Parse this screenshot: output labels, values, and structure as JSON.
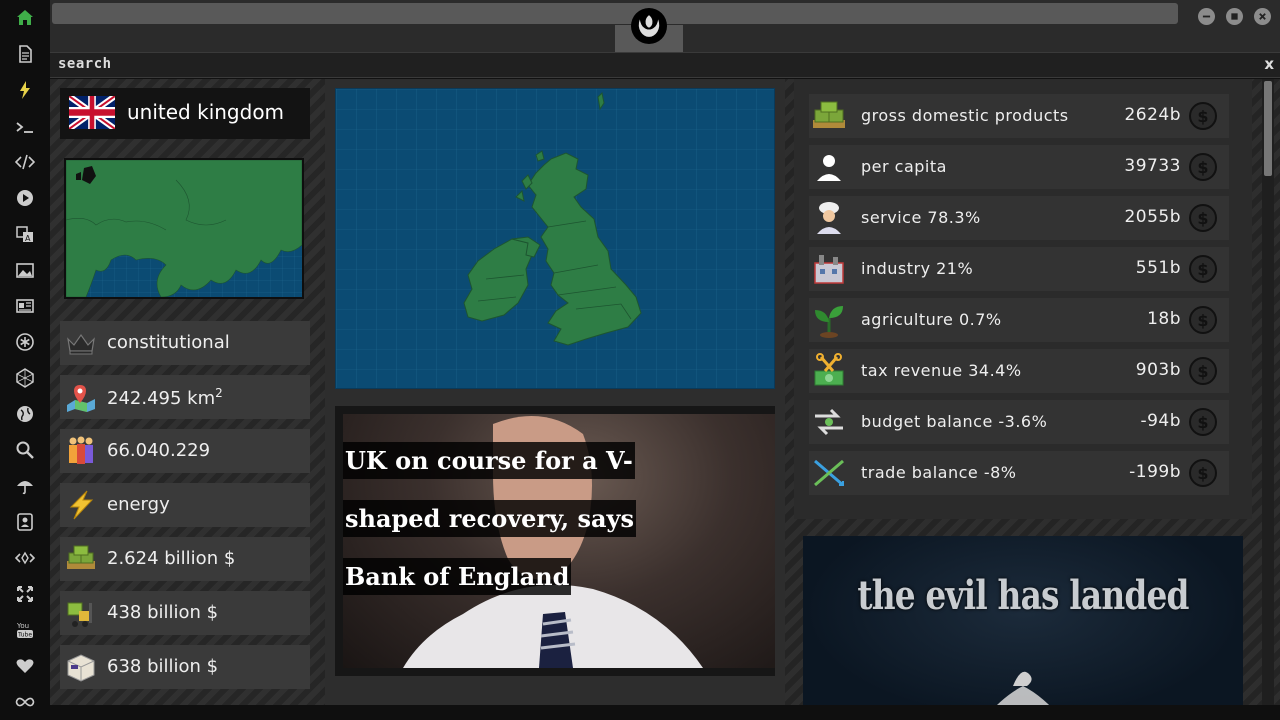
{
  "nav": {
    "icons": [
      "home-icon",
      "document-icon",
      "bolt-icon",
      "terminal-icon",
      "code-icon",
      "play-icon",
      "translate-icon",
      "image-icon",
      "newspaper-icon",
      "asterisk-icon",
      "hexagon-icon",
      "globe-icon",
      "search-icon",
      "umbrella-icon",
      "contact-icon",
      "ethereum-icon",
      "fullscreen-icon",
      "youtube-icon",
      "heart-icon",
      "infinity-icon"
    ]
  },
  "search": {
    "label": "search",
    "close": "x"
  },
  "country": {
    "name": "united kingdom",
    "government": "constitutional",
    "area": "242.495 km",
    "area_unit_sup": "2",
    "population": "66.040.229",
    "sector": "energy",
    "gdp": "2.624 billion $",
    "imports": "438 billion $",
    "exports": "638 billion $"
  },
  "news": {
    "headline": "UK on course for a V-shaped recovery, says Bank of England"
  },
  "stats": [
    {
      "label": "gross domestic products",
      "value": "2624b"
    },
    {
      "label": "per capita",
      "value": "39733"
    },
    {
      "label": "service 78.3%",
      "value": "2055b"
    },
    {
      "label": "industry 21%",
      "value": "551b"
    },
    {
      "label": "agriculture 0.7%",
      "value": "18b"
    },
    {
      "label": "tax revenue 34.4%",
      "value": "903b"
    },
    {
      "label": "budget balance -3.6%",
      "value": "-94b"
    },
    {
      "label": "trade balance -8%",
      "value": "-199b"
    }
  ],
  "dollar_symbol": "$",
  "promo": {
    "text": "the evil has landed"
  },
  "colors": {
    "accent_green": "#3fae49",
    "map_sea": "#0b4b73",
    "map_land": "#2e7d45"
  }
}
